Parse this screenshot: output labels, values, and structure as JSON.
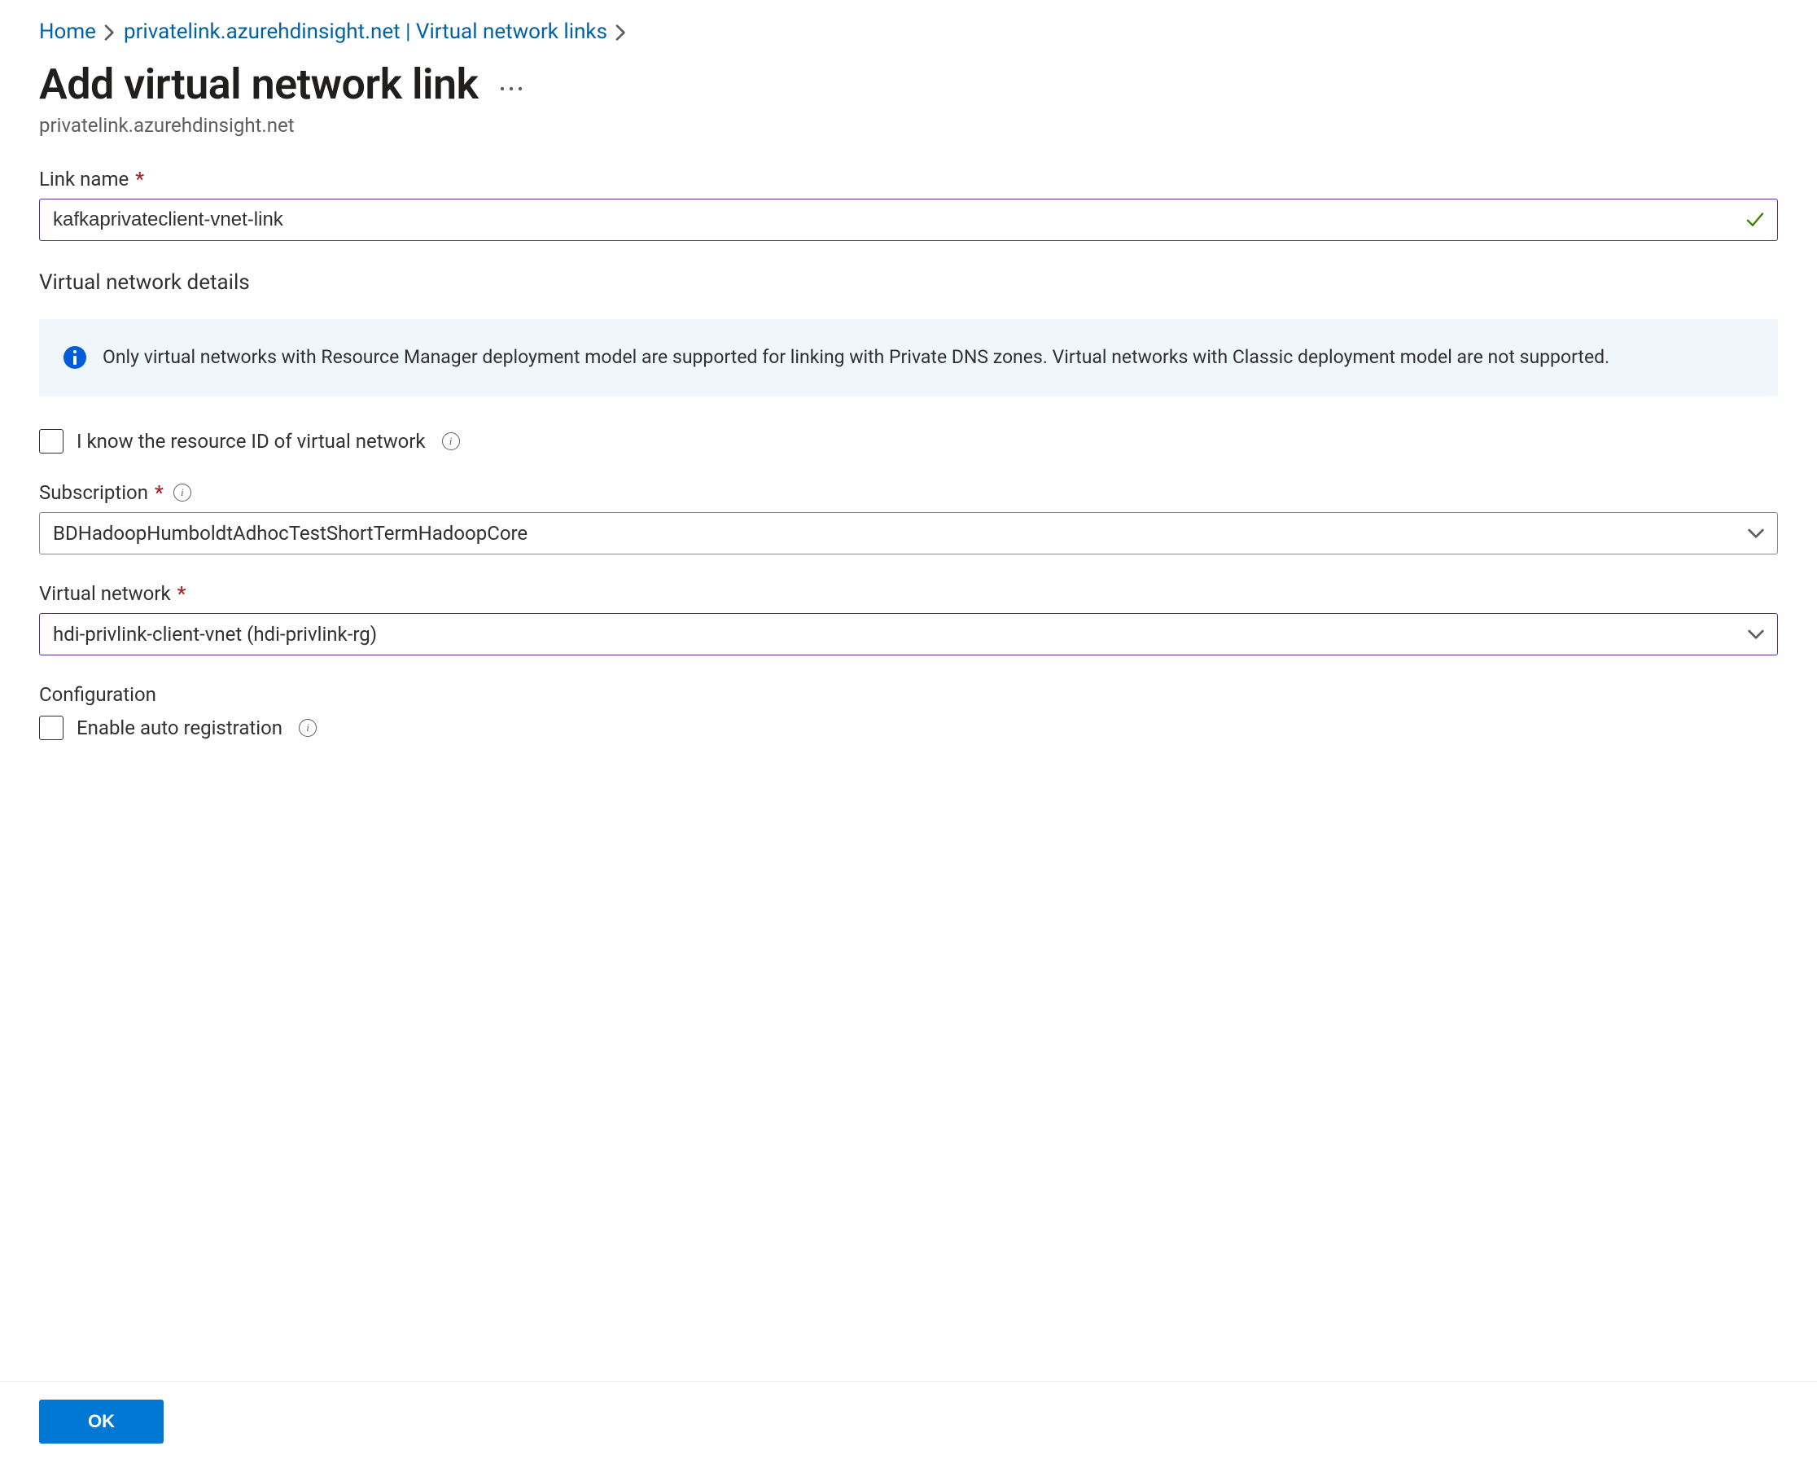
{
  "breadcrumb": {
    "home": "Home",
    "parent": "privatelink.azurehdinsight.net | Virtual network links"
  },
  "header": {
    "title": "Add virtual network link",
    "subtitle": "privatelink.azurehdinsight.net"
  },
  "form": {
    "link_name_label": "Link name",
    "link_name_value": "kafkaprivateclient-vnet-link",
    "section_vnet_details": "Virtual network details",
    "info_banner": "Only virtual networks with Resource Manager deployment model are supported for linking with Private DNS zones. Virtual networks with Classic deployment model are not supported.",
    "know_resource_id_label": "I know the resource ID of virtual network",
    "know_resource_id_checked": false,
    "subscription_label": "Subscription",
    "subscription_value": "BDHadoopHumboldtAdhocTestShortTermHadoopCore",
    "vnet_label": "Virtual network",
    "vnet_value": "hdi-privlink-client-vnet (hdi-privlink-rg)",
    "configuration_label": "Configuration",
    "enable_auto_reg_label": "Enable auto registration",
    "enable_auto_reg_checked": false
  },
  "footer": {
    "ok": "OK"
  }
}
